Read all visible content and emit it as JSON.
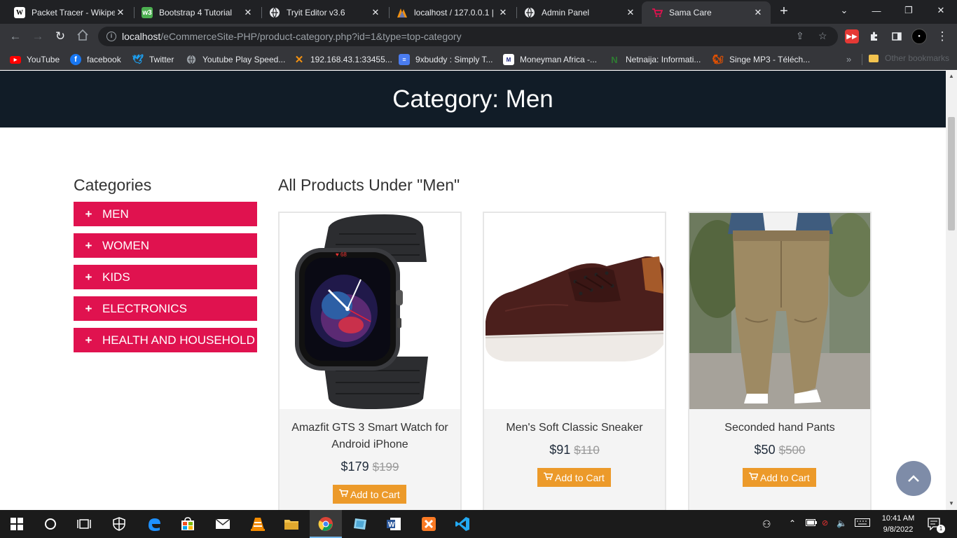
{
  "browser": {
    "tabs": [
      {
        "title": "Packet Tracer - Wikipe",
        "icon": "wikipedia-icon"
      },
      {
        "title": "Bootstrap 4 Tutorial",
        "icon": "w3schools-icon"
      },
      {
        "title": "Tryit Editor v3.6",
        "icon": "globe-icon"
      },
      {
        "title": "localhost / 127.0.0.1 |",
        "icon": "phpmyadmin-icon"
      },
      {
        "title": "Admin Panel",
        "icon": "globe-icon"
      },
      {
        "title": "Sama Care",
        "icon": "cart-icon"
      }
    ],
    "active_tab_index": 5,
    "url_host": "localhost",
    "url_path": "/eCommerceSite-PHP/product-category.php?id=1&type=top-category",
    "bookmarks": [
      {
        "label": "YouTube",
        "icon": "youtube-icon"
      },
      {
        "label": "facebook",
        "icon": "facebook-icon"
      },
      {
        "label": "Twitter",
        "icon": "twitter-icon"
      },
      {
        "label": "Youtube Play Speed...",
        "icon": "globe-icon"
      },
      {
        "label": "192.168.43.1:33455...",
        "icon": "xender-icon"
      },
      {
        "label": "9xbuddy : Simply T...",
        "icon": "doc-icon"
      },
      {
        "label": "Moneyman Africa -...",
        "icon": "mm-icon"
      },
      {
        "label": "Netnaija: Informati...",
        "icon": "netnaija-icon"
      },
      {
        "label": "Singe MP3 - Téléch...",
        "icon": "squirrel-icon"
      }
    ],
    "other_bookmarks": "Other bookmarks"
  },
  "page": {
    "banner_title": "Category: Men",
    "sidebar_title": "Categories",
    "categories": [
      "MEN",
      "WOMEN",
      "KIDS",
      "ELECTRONICS",
      "HEALTH AND HOUSEHOLD"
    ],
    "products_heading": "All Products Under \"Men\"",
    "products": [
      {
        "name": "Amazfit GTS 3 Smart Watch for Android iPhone",
        "price": "$179",
        "old_price": "$199",
        "button": "Add to Cart",
        "image": "smartwatch"
      },
      {
        "name": "Men's Soft Classic Sneaker",
        "price": "$91",
        "old_price": "$110",
        "button": "Add to Cart",
        "image": "sneaker"
      },
      {
        "name": "Seconded hand Pants",
        "price": "$50",
        "old_price": "$500",
        "button": "Add to Cart",
        "image": "pants"
      }
    ],
    "colors": {
      "banner": "#111c27",
      "category": "#e0124f",
      "cart_button": "#ec9a2a",
      "to_top": "#7e8ca8"
    }
  },
  "taskbar": {
    "time": "10:41 AM",
    "date": "9/8/2022",
    "notification_count": "1"
  }
}
